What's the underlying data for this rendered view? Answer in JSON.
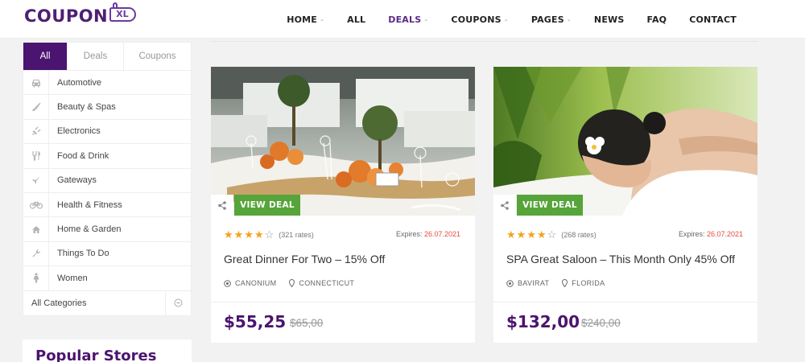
{
  "header": {
    "logo_text": "COUPON",
    "logo_tag": "XL",
    "nav": [
      {
        "label": "HOME",
        "dropdown": true
      },
      {
        "label": "ALL",
        "dropdown": false
      },
      {
        "label": "DEALS",
        "dropdown": true,
        "active": true
      },
      {
        "label": "COUPONS",
        "dropdown": true
      },
      {
        "label": "PAGES",
        "dropdown": true
      },
      {
        "label": "NEWS",
        "dropdown": false
      },
      {
        "label": "FAQ",
        "dropdown": false
      },
      {
        "label": "CONTACT",
        "dropdown": false
      }
    ],
    "caret": "⌄"
  },
  "sidebar": {
    "tabs": [
      "All",
      "Deals",
      "Coupons"
    ],
    "categories": [
      {
        "label": "Automotive",
        "icon": "car-icon"
      },
      {
        "label": "Beauty & Spas",
        "icon": "brush-icon"
      },
      {
        "label": "Electronics",
        "icon": "plug-icon"
      },
      {
        "label": "Food & Drink",
        "icon": "cutlery-icon"
      },
      {
        "label": "Gateways",
        "icon": "plane-icon"
      },
      {
        "label": "Health & Fitness",
        "icon": "bicycle-icon"
      },
      {
        "label": "Home & Garden",
        "icon": "home-icon"
      },
      {
        "label": "Things To Do",
        "icon": "wrench-icon"
      },
      {
        "label": "Women",
        "icon": "female-icon"
      }
    ],
    "all_categories": "All Categories"
  },
  "popular": {
    "title": "Popular Stores"
  },
  "cards": [
    {
      "button": "VIEW DEAL",
      "rating": 4,
      "rates": "(321 rates)",
      "expires_label": "Expires: ",
      "expires_date": "26.07.2021",
      "title": "Great Dinner For Two – 15% Off",
      "store": "CANONIUM",
      "location": "CONNECTICUT",
      "price": "$55,25",
      "old_price": "$65,00"
    },
    {
      "button": "VIEW DEAL",
      "rating": 4,
      "rates": "(268 rates)",
      "expires_label": "Expires: ",
      "expires_date": "26.07.2021",
      "title": "SPA Great Saloon – This Month Only 45% Off",
      "store": "BAVIRAT",
      "location": "FLORIDA",
      "price": "$132,00",
      "old_price": "$240,00"
    }
  ],
  "colors": {
    "brand": "#4b1470",
    "deal_green": "#56a43a",
    "star": "#f3a21a",
    "expires": "#e34b3e"
  }
}
